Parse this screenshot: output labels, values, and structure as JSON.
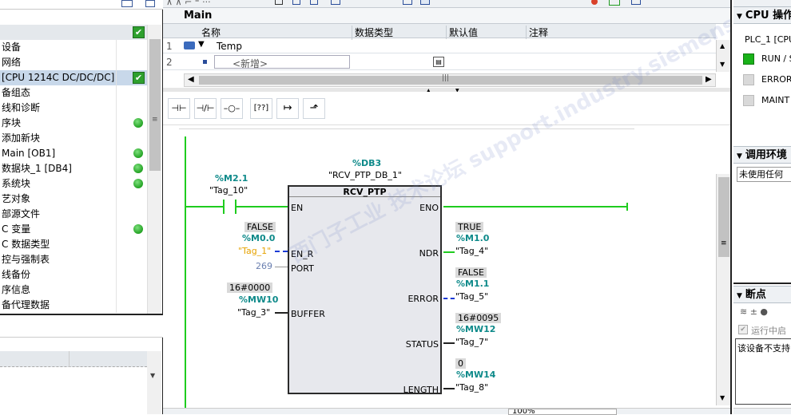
{
  "left_tree": {
    "items": [
      {
        "label": "设备",
        "status": "none"
      },
      {
        "label": "网络",
        "status": "none"
      },
      {
        "label": "[CPU 1214C DC/DC/DC]",
        "status": "check",
        "selected": true
      },
      {
        "label": "备组态",
        "status": "none"
      },
      {
        "label": "线和诊断",
        "status": "none"
      },
      {
        "label": "序块",
        "status": "dot"
      },
      {
        "label": "添加新块",
        "status": "none"
      },
      {
        "label": "Main [OB1]",
        "status": "dot"
      },
      {
        "label": "数据块_1 [DB4]",
        "status": "dot"
      },
      {
        "label": "系统块",
        "status": "dot"
      },
      {
        "label": "艺对象",
        "status": "none"
      },
      {
        "label": "部源文件",
        "status": "none"
      },
      {
        "label": "C 变量",
        "status": "dot"
      },
      {
        "label": "C 数据类型",
        "status": "none"
      },
      {
        "label": "控与强制表",
        "status": "none"
      },
      {
        "label": "线备份",
        "status": "none"
      },
      {
        "label": "序信息",
        "status": "none"
      },
      {
        "label": "备代理数据",
        "status": "none"
      }
    ]
  },
  "editor": {
    "block_title": "Main",
    "interface_headers": {
      "name": "名称",
      "type": "数据类型",
      "default": "默认值",
      "comment": "注释"
    },
    "interface_rows": [
      {
        "num": "1",
        "name": "Temp"
      },
      {
        "num": "2",
        "name": "<新增>"
      }
    ],
    "zoom": "100%"
  },
  "ladder": {
    "contact": {
      "address": "%M2.1",
      "tag": "\"Tag_10\""
    },
    "instance": {
      "db": "%DB3",
      "name": "\"RCV_PTP_DB_1\""
    },
    "box_title": "RCV_PTP",
    "pins_left": {
      "en": "EN",
      "en_r": "EN_R",
      "port": "PORT",
      "buffer": "BUFFER"
    },
    "pins_right": {
      "eno": "ENO",
      "ndr": "NDR",
      "error": "ERROR",
      "status": "STATUS",
      "length": "LENGTH"
    },
    "en_r": {
      "value": "FALSE",
      "address": "%M0.0",
      "tag": "\"Tag_1\""
    },
    "port_value": "269",
    "buffer": {
      "value": "16#0000",
      "address": "%MW10",
      "tag": "\"Tag_3\""
    },
    "ndr": {
      "value": "TRUE",
      "address": "%M1.0",
      "tag": "\"Tag_4\""
    },
    "error": {
      "value": "FALSE",
      "address": "%M1.1",
      "tag": "\"Tag_5\""
    },
    "status": {
      "value": "16#0095",
      "address": "%MW12",
      "tag": "\"Tag_7\""
    },
    "length": {
      "value": "0",
      "address": "%MW14",
      "tag": "\"Tag_8\""
    }
  },
  "right_panel": {
    "cpu_header": "CPU 操作",
    "plc_label": "PLC_1 [CPU",
    "leds": [
      {
        "label": "RUN / S",
        "color": "#19b219"
      },
      {
        "label": "ERROR",
        "color": "#d9d9d9"
      },
      {
        "label": "MAINT",
        "color": "#d9d9d9"
      }
    ],
    "call_env_header": "调用环境",
    "call_env_value": "未使用任何",
    "breakpoints_header": "断点",
    "run_check_label": "运行中启",
    "unsupported_text": "该设备不支持"
  },
  "watermark": "西门子工业 技术论坛 support.industry.siemens.com/cs",
  "colors": {
    "wire": "#1fcc1f",
    "teal": "#0e8a8a",
    "orange": "#e6a200",
    "blue_wire": "#1a3ad6"
  }
}
